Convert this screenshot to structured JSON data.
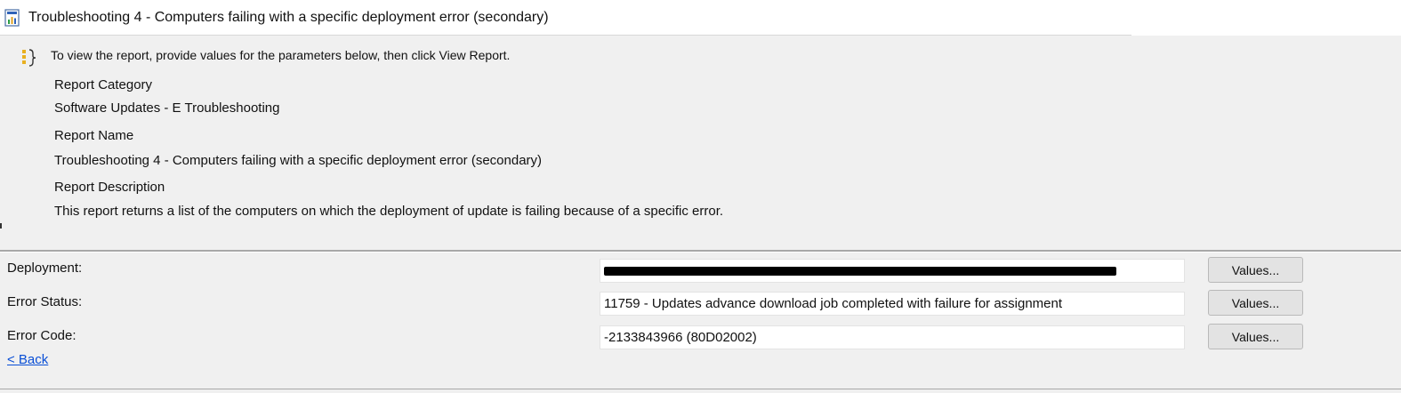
{
  "window": {
    "title": "Troubleshooting 4 - Computers failing with a specific deployment error (secondary)",
    "icon": "report-icon"
  },
  "parameters_panel": {
    "icon": "info-brace-icon",
    "instruction": "To view the report, provide values for the parameters below, then click View Report.",
    "report_category_label": "Report Category",
    "report_category_value": "Software Updates - E Troubleshooting",
    "report_name_label": "Report Name",
    "report_name_value": "Troubleshooting 4 - Computers failing with a specific deployment error (secondary)",
    "report_description_label": "Report Description",
    "report_description_value": "This report returns a list of the computers on which the deployment of update is failing because of a specific error."
  },
  "fields": {
    "deployment": {
      "label": "Deployment:",
      "value": "",
      "redacted": true,
      "button": "Values..."
    },
    "error_status": {
      "label": "Error Status:",
      "value": "11759 - Updates advance download job completed with failure for assignment",
      "button": "Values..."
    },
    "error_code": {
      "label": "Error Code:",
      "value": "-2133843966 (80D02002)",
      "button": "Values..."
    }
  },
  "back_link": "< Back",
  "colors": {
    "background": "#f0f0f0",
    "link": "#0a4fd6",
    "button_face": "#e3e3e3"
  }
}
